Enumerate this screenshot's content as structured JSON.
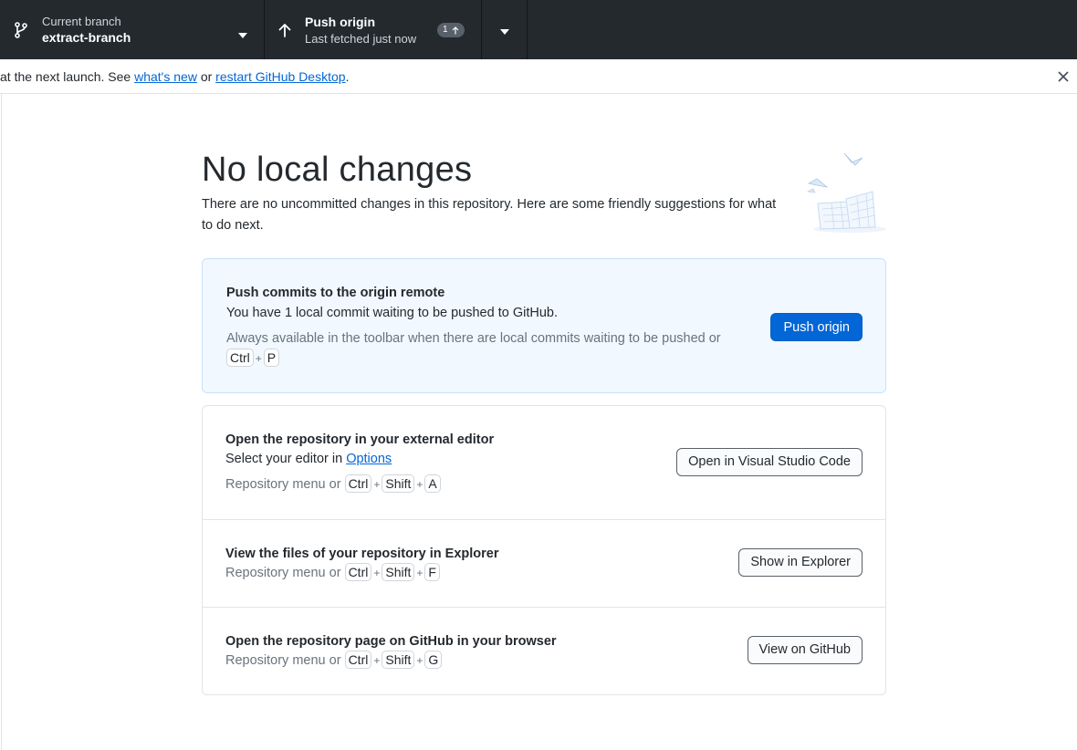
{
  "toolbar": {
    "branch": {
      "description": "Current branch",
      "title": "extract-branch"
    },
    "push": {
      "title": "Push origin",
      "description": "Last fetched just now",
      "badge_count": "1"
    }
  },
  "banner": {
    "prefix": "at the next launch. See ",
    "whats_new": "what's new",
    "middle": " or ",
    "restart": "restart GitHub Desktop",
    "suffix": "."
  },
  "main": {
    "title": "No local changes",
    "intro": "There are no uncommitted changes in this repository. Here are some friendly suggestions for what to do next."
  },
  "push_card": {
    "title": "Push commits to the origin remote",
    "subtitle": "You have 1 local commit waiting to be pushed to GitHub.",
    "hint": "Always available in the toolbar when there are local commits waiting to be pushed or",
    "keys": [
      "Ctrl",
      "P"
    ],
    "button": "Push origin"
  },
  "actions": [
    {
      "title": "Open the repository in your external editor",
      "subtitle_prefix": "Select your editor in ",
      "subtitle_link": "Options",
      "hint": "Repository menu or",
      "keys": [
        "Ctrl",
        "Shift",
        "A"
      ],
      "button": "Open in Visual Studio Code"
    },
    {
      "title": "View the files of your repository in Explorer",
      "hint": "Repository menu or",
      "keys": [
        "Ctrl",
        "Shift",
        "F"
      ],
      "button": "Show in Explorer"
    },
    {
      "title": "Open the repository page on GitHub in your browser",
      "hint": "Repository menu or",
      "keys": [
        "Ctrl",
        "Shift",
        "G"
      ],
      "button": "View on GitHub"
    }
  ],
  "plus": "+",
  "colors": {
    "toolbar": "#24292e",
    "accent": "#0366d6",
    "push_card_bg": "#f1f8ff"
  },
  "icons": [
    "git-branch-icon",
    "caret-down-icon",
    "arrow-up-icon",
    "close-icon"
  ]
}
